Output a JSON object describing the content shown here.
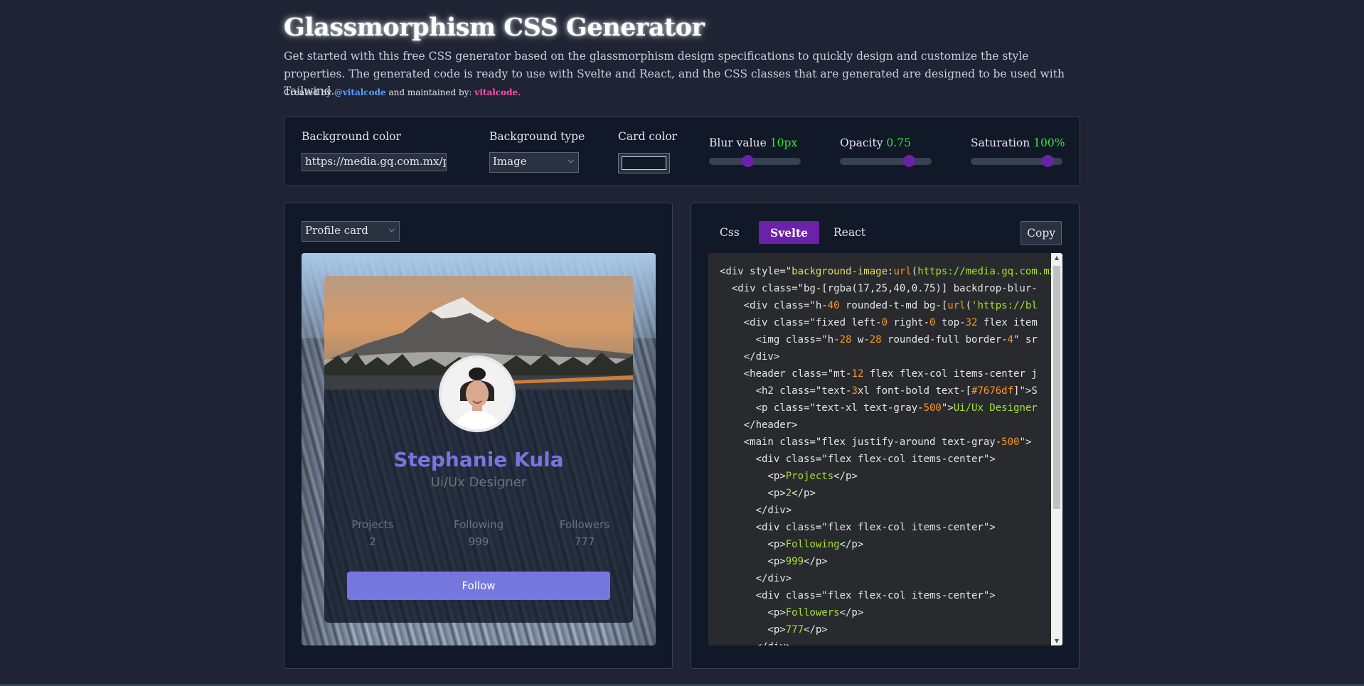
{
  "header": {
    "title": "Glassmorphism CSS Generator",
    "description": "Get started with this free CSS generator based on the glassmorphism design specifications to quickly design and customize the style properties. The generated code is ready to use with Svelte and React, and the CSS classes that are generated are designed to be used with Tailwind.",
    "created_by_label": "Created by ",
    "creator": "@vitalcode",
    "maintained_label": " and maintained by: ",
    "maintainer": "vitalcode",
    "end": "."
  },
  "controls": {
    "background_color_label": "Background color",
    "background_color_value": "https://media.gq.com.mx/ph",
    "background_type_label": "Background type",
    "background_type_value": "Image",
    "card_color_label": "Card color",
    "card_color_value": "#111927",
    "blur_label": "Blur value ",
    "blur_value": "10px",
    "blur_level": 0.42,
    "opacity_label": "Opacity ",
    "opacity_value": "0.75",
    "opacity_level": 0.75,
    "saturation_label": "Saturation ",
    "saturation_value": "100%",
    "saturation_level": 0.84
  },
  "preview": {
    "card_type": "Profile card",
    "name": "Stephanie Kula",
    "role": "Ui/Ux Designer",
    "stats": [
      {
        "label": "Projects",
        "value": "2"
      },
      {
        "label": "Following",
        "value": "999"
      },
      {
        "label": "Followers",
        "value": "777"
      }
    ],
    "follow_label": "Follow"
  },
  "code_panel": {
    "tabs": [
      {
        "label": "Css",
        "active": false
      },
      {
        "label": "Svelte",
        "active": true
      },
      {
        "label": "React",
        "active": false
      }
    ],
    "copy_label": "Copy"
  },
  "colors": {
    "accent_purple": "#6b21a8",
    "name_color": "#7676df",
    "value_green": "#39e639",
    "link_blue": "#5aa0ff",
    "link_pink": "#ff4fae"
  }
}
